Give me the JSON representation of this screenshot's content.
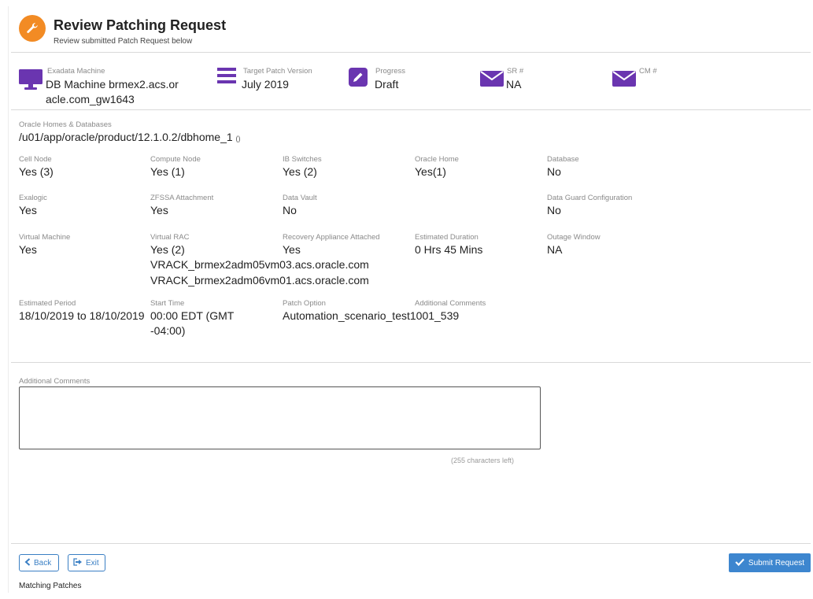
{
  "header": {
    "title": "Review Patching Request",
    "subtitle": "Review submitted Patch Request below",
    "icon": "wrench-icon",
    "icon_color": "#f28b24"
  },
  "summary": {
    "exadata": {
      "label": "Exadata Machine",
      "value_line1": "DB Machine brmex2.acs.or",
      "value_line2": "acle.com_gw1643",
      "icon": "monitor-icon"
    },
    "target": {
      "label": "Target Patch Version",
      "value": "July 2019",
      "icon": "list-icon"
    },
    "progress": {
      "label": "Progress",
      "value": "Draft",
      "icon": "edit-icon"
    },
    "sr": {
      "label": "SR #",
      "value": "NA",
      "icon": "envelope-icon"
    },
    "cm": {
      "label": "CM #",
      "value": "",
      "icon": "envelope-icon"
    },
    "accent_color": "#6a35b0"
  },
  "homes": {
    "label": "Oracle Homes & Databases",
    "value": "/u01/app/oracle/product/12.1.0.2/dbhome_1",
    "suffix": "()"
  },
  "details": {
    "cell_node": {
      "label": "Cell Node",
      "value": "Yes (3)"
    },
    "compute_node": {
      "label": "Compute Node",
      "value": "Yes (1)"
    },
    "ib_switches": {
      "label": "IB Switches",
      "value": "Yes (2)"
    },
    "oracle_home": {
      "label": "Oracle Home",
      "value": "Yes(1)"
    },
    "database": {
      "label": "Database",
      "value": "No"
    },
    "exalogic": {
      "label": "Exalogic",
      "value": "Yes"
    },
    "zfssa": {
      "label": "ZFSSA Attachment",
      "value": "Yes"
    },
    "data_vault": {
      "label": "Data Vault",
      "value": "No"
    },
    "data_guard": {
      "label": "Data Guard Configuration",
      "value": "No"
    },
    "virtual_machine": {
      "label": "Virtual Machine",
      "value": "Yes"
    },
    "virtual_rac": {
      "label": "Virtual RAC",
      "value": "Yes (2)",
      "hosts": [
        "VRACK_brmex2adm05vm03.acs.oracle.com",
        "VRACK_brmex2adm06vm01.acs.oracle.com"
      ]
    },
    "recovery_appliance": {
      "label": "Recovery Appliance Attached",
      "value": "Yes"
    },
    "estimated_duration": {
      "label": "Estimated Duration",
      "value": "0 Hrs 45 Mins"
    },
    "outage_window": {
      "label": "Outage Window",
      "value": "NA"
    },
    "estimated_period": {
      "label": "Estimated Period",
      "value": "18/10/2019 to 18/10/2019"
    },
    "start_time": {
      "label": "Start Time",
      "value_line1": "00:00 EDT (GMT",
      "value_line2": "-04:00)"
    },
    "patch_option": {
      "label": "Patch Option",
      "value": "Automation_scenario_test1001_539"
    },
    "additional_comments_top": {
      "label": "Additional Comments",
      "value": ""
    }
  },
  "comments": {
    "label": "Additional Comments",
    "value": "",
    "chars_left": "(255 characters left)"
  },
  "footer": {
    "back_label": "Back",
    "exit_label": "Exit",
    "submit_label": "Submit Request",
    "matching_label": "Matching Patches",
    "primary_color": "#3d86cf"
  }
}
